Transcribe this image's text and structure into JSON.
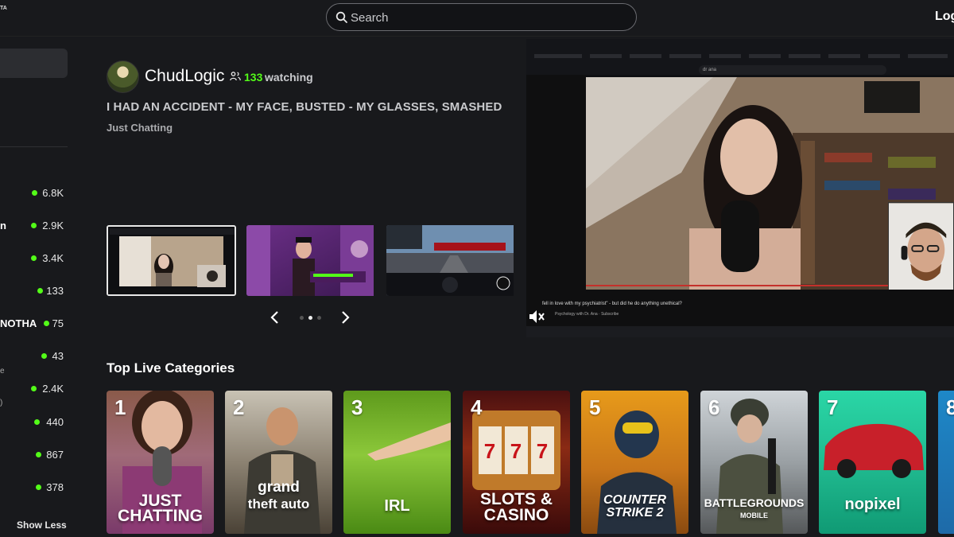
{
  "header": {
    "logo_text": "TA",
    "search_placeholder": "Search",
    "login_label": "Log"
  },
  "sidebar": {
    "rows": [
      {
        "name_fragment": "",
        "viewers": "6.8K"
      },
      {
        "name_fragment": "n",
        "viewers": "2.9K"
      },
      {
        "name_fragment": "",
        "viewers": "3.4K"
      },
      {
        "name_fragment": "",
        "viewers": "133"
      },
      {
        "name_fragment": "NOTHA",
        "viewers": "75"
      },
      {
        "name_fragment": "",
        "viewers": "43"
      },
      {
        "name_fragment": "",
        "viewers": "2.4K"
      },
      {
        "name_fragment": "",
        "viewers": "440"
      },
      {
        "name_fragment": "",
        "viewers": "867"
      },
      {
        "name_fragment": "",
        "viewers": "378"
      }
    ],
    "small_fragments": [
      "e",
      ")"
    ],
    "show_less_label": "Show Less"
  },
  "featured": {
    "channel_name": "ChudLogic",
    "viewer_count": "133",
    "viewer_word": "watching",
    "title": "I HAD AN ACCIDENT - MY FACE, BUSTED - MY GLASSES, SMASHED",
    "category": "Just Chatting"
  },
  "player": {
    "address_text": "dr ana",
    "video_title": "fell in love with my psychiatrist\" - but did he do anything unethical?",
    "video_channel": "Psychology with Dr. Ana · Subscribe"
  },
  "categories": {
    "heading": "Top Live Categories",
    "items": [
      {
        "rank": "1",
        "label_line1": "JUST",
        "label_line2": "CHATTING"
      },
      {
        "rank": "2",
        "label_line1": "grand",
        "label_line2": "theft auto"
      },
      {
        "rank": "3",
        "label_line1": "IRL",
        "label_line2": ""
      },
      {
        "rank": "4",
        "label_line1": "SLOTS &",
        "label_line2": "CASINO"
      },
      {
        "rank": "5",
        "label_line1": "COUNTER",
        "label_line2": "STRIKE 2"
      },
      {
        "rank": "6",
        "label_line1": "BATTLEGROUNDS",
        "label_line2": "MOBILE"
      },
      {
        "rank": "7",
        "label_line1": "nopixel",
        "label_line2": ""
      },
      {
        "rank": "8",
        "label_line1": "",
        "label_line2": ""
      }
    ]
  },
  "colors": {
    "accent": "#53fc18",
    "background": "#18191c",
    "youtube_red": "#c4302b"
  }
}
